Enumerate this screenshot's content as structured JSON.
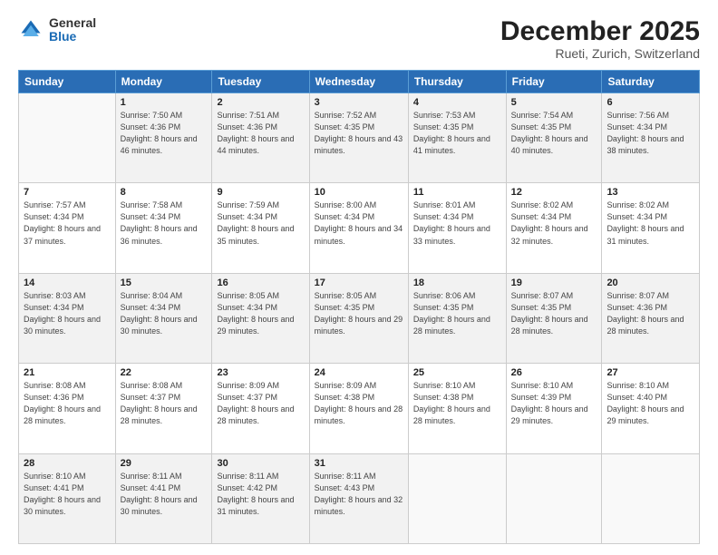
{
  "logo": {
    "general": "General",
    "blue": "Blue"
  },
  "header": {
    "month": "December 2025",
    "location": "Rueti, Zurich, Switzerland"
  },
  "days_of_week": [
    "Sunday",
    "Monday",
    "Tuesday",
    "Wednesday",
    "Thursday",
    "Friday",
    "Saturday"
  ],
  "weeks": [
    [
      {
        "day": "",
        "sunrise": "",
        "sunset": "",
        "daylight": ""
      },
      {
        "day": "1",
        "sunrise": "Sunrise: 7:50 AM",
        "sunset": "Sunset: 4:36 PM",
        "daylight": "Daylight: 8 hours and 46 minutes."
      },
      {
        "day": "2",
        "sunrise": "Sunrise: 7:51 AM",
        "sunset": "Sunset: 4:36 PM",
        "daylight": "Daylight: 8 hours and 44 minutes."
      },
      {
        "day": "3",
        "sunrise": "Sunrise: 7:52 AM",
        "sunset": "Sunset: 4:35 PM",
        "daylight": "Daylight: 8 hours and 43 minutes."
      },
      {
        "day": "4",
        "sunrise": "Sunrise: 7:53 AM",
        "sunset": "Sunset: 4:35 PM",
        "daylight": "Daylight: 8 hours and 41 minutes."
      },
      {
        "day": "5",
        "sunrise": "Sunrise: 7:54 AM",
        "sunset": "Sunset: 4:35 PM",
        "daylight": "Daylight: 8 hours and 40 minutes."
      },
      {
        "day": "6",
        "sunrise": "Sunrise: 7:56 AM",
        "sunset": "Sunset: 4:34 PM",
        "daylight": "Daylight: 8 hours and 38 minutes."
      }
    ],
    [
      {
        "day": "7",
        "sunrise": "Sunrise: 7:57 AM",
        "sunset": "Sunset: 4:34 PM",
        "daylight": "Daylight: 8 hours and 37 minutes."
      },
      {
        "day": "8",
        "sunrise": "Sunrise: 7:58 AM",
        "sunset": "Sunset: 4:34 PM",
        "daylight": "Daylight: 8 hours and 36 minutes."
      },
      {
        "day": "9",
        "sunrise": "Sunrise: 7:59 AM",
        "sunset": "Sunset: 4:34 PM",
        "daylight": "Daylight: 8 hours and 35 minutes."
      },
      {
        "day": "10",
        "sunrise": "Sunrise: 8:00 AM",
        "sunset": "Sunset: 4:34 PM",
        "daylight": "Daylight: 8 hours and 34 minutes."
      },
      {
        "day": "11",
        "sunrise": "Sunrise: 8:01 AM",
        "sunset": "Sunset: 4:34 PM",
        "daylight": "Daylight: 8 hours and 33 minutes."
      },
      {
        "day": "12",
        "sunrise": "Sunrise: 8:02 AM",
        "sunset": "Sunset: 4:34 PM",
        "daylight": "Daylight: 8 hours and 32 minutes."
      },
      {
        "day": "13",
        "sunrise": "Sunrise: 8:02 AM",
        "sunset": "Sunset: 4:34 PM",
        "daylight": "Daylight: 8 hours and 31 minutes."
      }
    ],
    [
      {
        "day": "14",
        "sunrise": "Sunrise: 8:03 AM",
        "sunset": "Sunset: 4:34 PM",
        "daylight": "Daylight: 8 hours and 30 minutes."
      },
      {
        "day": "15",
        "sunrise": "Sunrise: 8:04 AM",
        "sunset": "Sunset: 4:34 PM",
        "daylight": "Daylight: 8 hours and 30 minutes."
      },
      {
        "day": "16",
        "sunrise": "Sunrise: 8:05 AM",
        "sunset": "Sunset: 4:34 PM",
        "daylight": "Daylight: 8 hours and 29 minutes."
      },
      {
        "day": "17",
        "sunrise": "Sunrise: 8:05 AM",
        "sunset": "Sunset: 4:35 PM",
        "daylight": "Daylight: 8 hours and 29 minutes."
      },
      {
        "day": "18",
        "sunrise": "Sunrise: 8:06 AM",
        "sunset": "Sunset: 4:35 PM",
        "daylight": "Daylight: 8 hours and 28 minutes."
      },
      {
        "day": "19",
        "sunrise": "Sunrise: 8:07 AM",
        "sunset": "Sunset: 4:35 PM",
        "daylight": "Daylight: 8 hours and 28 minutes."
      },
      {
        "day": "20",
        "sunrise": "Sunrise: 8:07 AM",
        "sunset": "Sunset: 4:36 PM",
        "daylight": "Daylight: 8 hours and 28 minutes."
      }
    ],
    [
      {
        "day": "21",
        "sunrise": "Sunrise: 8:08 AM",
        "sunset": "Sunset: 4:36 PM",
        "daylight": "Daylight: 8 hours and 28 minutes."
      },
      {
        "day": "22",
        "sunrise": "Sunrise: 8:08 AM",
        "sunset": "Sunset: 4:37 PM",
        "daylight": "Daylight: 8 hours and 28 minutes."
      },
      {
        "day": "23",
        "sunrise": "Sunrise: 8:09 AM",
        "sunset": "Sunset: 4:37 PM",
        "daylight": "Daylight: 8 hours and 28 minutes."
      },
      {
        "day": "24",
        "sunrise": "Sunrise: 8:09 AM",
        "sunset": "Sunset: 4:38 PM",
        "daylight": "Daylight: 8 hours and 28 minutes."
      },
      {
        "day": "25",
        "sunrise": "Sunrise: 8:10 AM",
        "sunset": "Sunset: 4:38 PM",
        "daylight": "Daylight: 8 hours and 28 minutes."
      },
      {
        "day": "26",
        "sunrise": "Sunrise: 8:10 AM",
        "sunset": "Sunset: 4:39 PM",
        "daylight": "Daylight: 8 hours and 29 minutes."
      },
      {
        "day": "27",
        "sunrise": "Sunrise: 8:10 AM",
        "sunset": "Sunset: 4:40 PM",
        "daylight": "Daylight: 8 hours and 29 minutes."
      }
    ],
    [
      {
        "day": "28",
        "sunrise": "Sunrise: 8:10 AM",
        "sunset": "Sunset: 4:41 PM",
        "daylight": "Daylight: 8 hours and 30 minutes."
      },
      {
        "day": "29",
        "sunrise": "Sunrise: 8:11 AM",
        "sunset": "Sunset: 4:41 PM",
        "daylight": "Daylight: 8 hours and 30 minutes."
      },
      {
        "day": "30",
        "sunrise": "Sunrise: 8:11 AM",
        "sunset": "Sunset: 4:42 PM",
        "daylight": "Daylight: 8 hours and 31 minutes."
      },
      {
        "day": "31",
        "sunrise": "Sunrise: 8:11 AM",
        "sunset": "Sunset: 4:43 PM",
        "daylight": "Daylight: 8 hours and 32 minutes."
      },
      {
        "day": "",
        "sunrise": "",
        "sunset": "",
        "daylight": ""
      },
      {
        "day": "",
        "sunrise": "",
        "sunset": "",
        "daylight": ""
      },
      {
        "day": "",
        "sunrise": "",
        "sunset": "",
        "daylight": ""
      }
    ]
  ]
}
